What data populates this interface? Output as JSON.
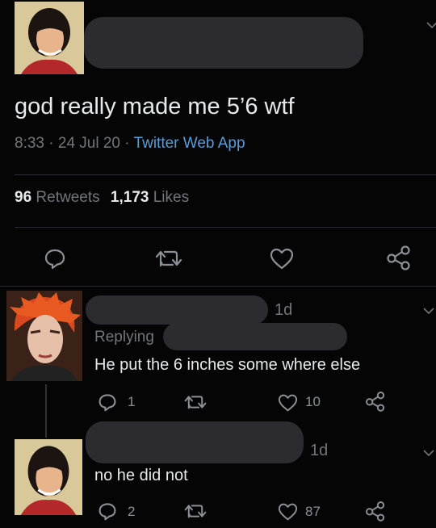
{
  "main_tweet": {
    "avatar_icon": "person-avatar",
    "text": "god really made me 5’6 wtf",
    "time": "8:33",
    "sep1": "·",
    "date": "24 Jul 20",
    "sep2": "·",
    "source": "Twitter Web App",
    "retweets_count": "96",
    "retweets_label": "Retweets",
    "likes_count": "1,173",
    "likes_label": "Likes",
    "actions": [
      "reply-icon",
      "retweet-icon",
      "like-icon",
      "share-icon"
    ]
  },
  "replies": [
    {
      "avatar_icon": "person-avatar-red-hair",
      "age": "1d",
      "replying_label": "Replying",
      "text": "He put the 6 inches some where else",
      "reply_count": "1",
      "like_count": "10"
    },
    {
      "avatar_icon": "person-avatar",
      "age": "1d",
      "text": "no he did not",
      "reply_count": "2",
      "like_count": "87"
    }
  ],
  "colors": {
    "background": "#050505",
    "text": "#e7e9ea",
    "muted": "#71767b",
    "link": "#5b9bd8",
    "redaction": "#2c2c30"
  }
}
